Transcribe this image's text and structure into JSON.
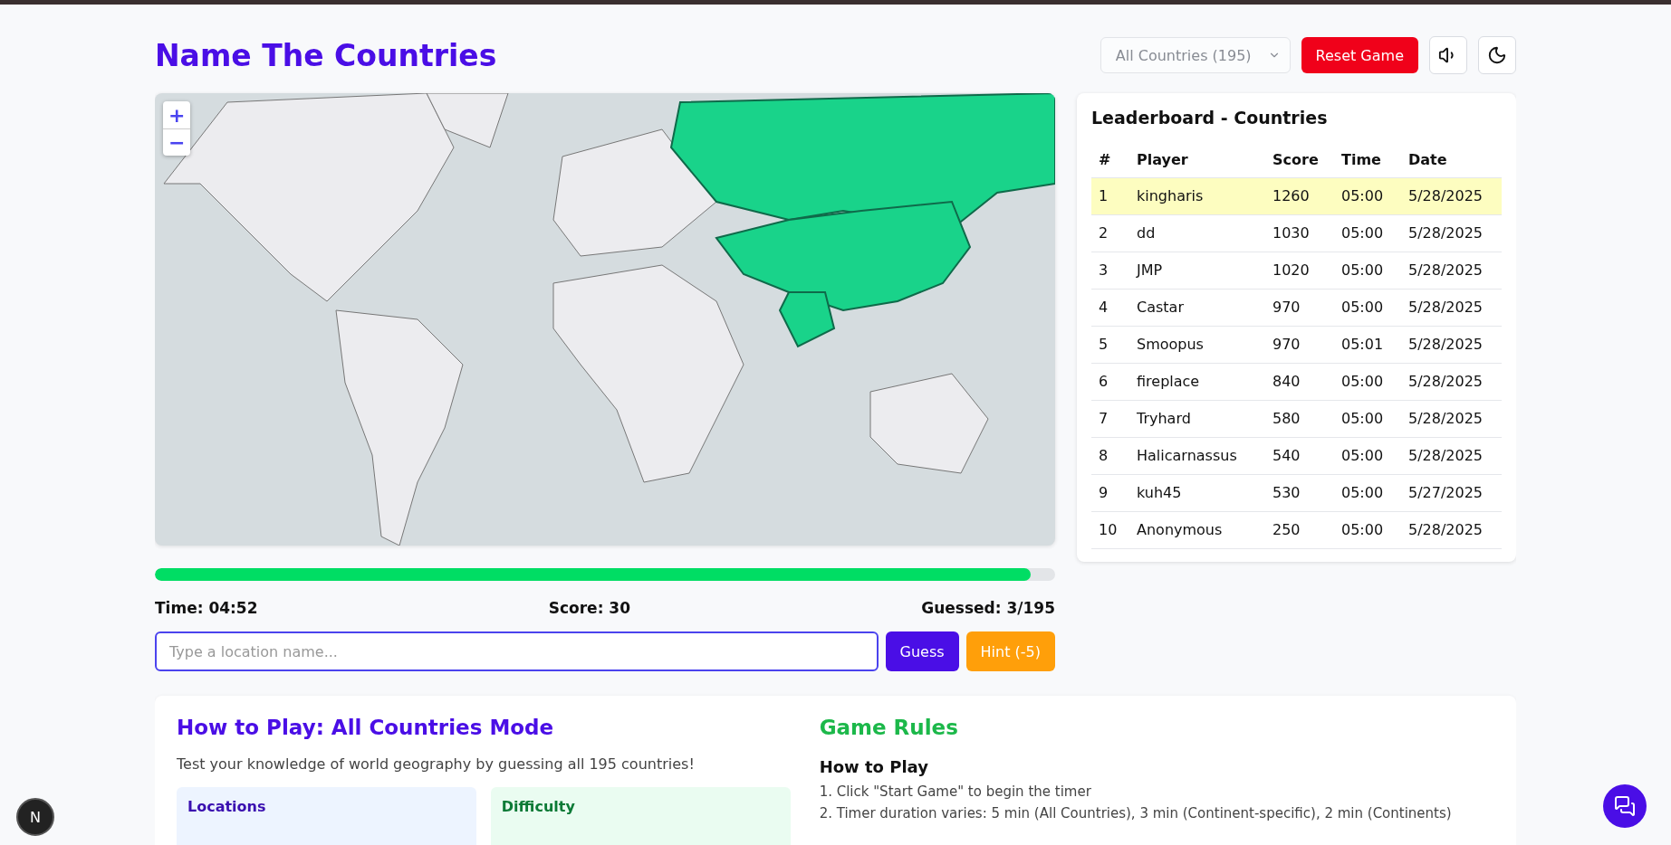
{
  "header": {
    "title": "Name The Countries",
    "mode_select": {
      "value": "All Countries (195)"
    },
    "reset_button": "Reset Game"
  },
  "map": {
    "zoom_in": "+",
    "zoom_out": "−"
  },
  "progress": {
    "level": 0.973
  },
  "stats": {
    "time": "Time: 04:52",
    "score": "Score: 30",
    "guessed": "Guessed: 3/195"
  },
  "guess_input": {
    "placeholder": "Type a location name..."
  },
  "guess_button": "Guess",
  "hint_button": "Hint (-5)",
  "leaderboard": {
    "title": "Leaderboard - Countries",
    "columns": [
      "#",
      "Player",
      "Score",
      "Time",
      "Date"
    ],
    "rows": [
      {
        "rank": "1",
        "player": "kingharis",
        "score": "1260",
        "time": "05:00",
        "date": "5/28/2025",
        "selected": true
      },
      {
        "rank": "2",
        "player": "dd",
        "score": "1030",
        "time": "05:00",
        "date": "5/28/2025",
        "selected": false
      },
      {
        "rank": "3",
        "player": "JMP",
        "score": "1020",
        "time": "05:00",
        "date": "5/28/2025",
        "selected": false
      },
      {
        "rank": "4",
        "player": "Castar",
        "score": "970",
        "time": "05:00",
        "date": "5/28/2025",
        "selected": false
      },
      {
        "rank": "5",
        "player": "Smoopus",
        "score": "970",
        "time": "05:01",
        "date": "5/28/2025",
        "selected": false
      },
      {
        "rank": "6",
        "player": "fireplace",
        "score": "840",
        "time": "05:00",
        "date": "5/28/2025",
        "selected": false
      },
      {
        "rank": "7",
        "player": "Tryhard",
        "score": "580",
        "time": "05:00",
        "date": "5/28/2025",
        "selected": false
      },
      {
        "rank": "8",
        "player": "Halicarnassus",
        "score": "540",
        "time": "05:00",
        "date": "5/28/2025",
        "selected": false
      },
      {
        "rank": "9",
        "player": "kuh45",
        "score": "530",
        "time": "05:00",
        "date": "5/27/2025",
        "selected": false
      },
      {
        "rank": "10",
        "player": "Anonymous",
        "score": "250",
        "time": "05:00",
        "date": "5/28/2025",
        "selected": false
      }
    ]
  },
  "how_to_play": {
    "title": "How to Play: All Countries Mode",
    "intro": "Test your knowledge of world geography by guessing all 195 countries!",
    "cards": [
      {
        "title": "Locations"
      },
      {
        "title": "Difficulty"
      }
    ]
  },
  "game_rules": {
    "title": "Game Rules",
    "subtitle": "How to Play",
    "steps": [
      "1. Click \"Start Game\" to begin the timer",
      "2. Timer duration varies: 5 min (All Countries), 3 min (Continent-specific), 2 min (Continents)"
    ]
  },
  "dev_badge": "N"
}
